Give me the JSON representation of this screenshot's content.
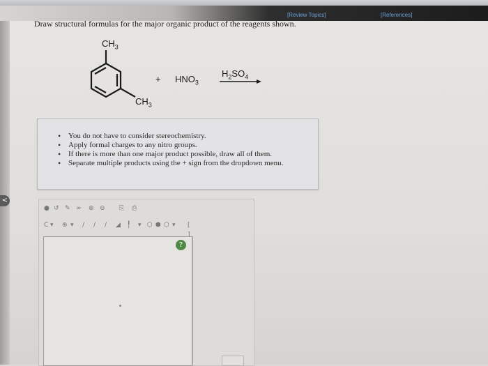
{
  "header": {
    "review_topics": "[Review Topics]",
    "references": "[References]"
  },
  "question": "Draw structural formulas for the major organic product of the reagents shown.",
  "reaction": {
    "ch3_top": "CH3",
    "ch3_bottom": "CH3",
    "plus": "+",
    "reagent": "HNO3",
    "catalyst": "H2SO4"
  },
  "notes": [
    "You do not have to consider stereochemistry.",
    "Apply formal charges to any nitro groups.",
    "If there is more than one major product possible, draw all of them.",
    "Separate multiple products using the + sign from the dropdown menu."
  ],
  "editor": {
    "toolbar_icons": [
      "undo-icon",
      "redo-icon",
      "eraser-icon",
      "lasso-icon",
      "zoom-in-icon",
      "zoom-out-icon",
      "copy-icon",
      "paste-icon"
    ],
    "bond_tools": [
      "single-bond-icon",
      "double-bond-icon",
      "triple-bond-icon",
      "wedge-bond-icon",
      "ring-icon"
    ],
    "element_label": "C",
    "charge_label": "⊕",
    "help_label": "?"
  }
}
